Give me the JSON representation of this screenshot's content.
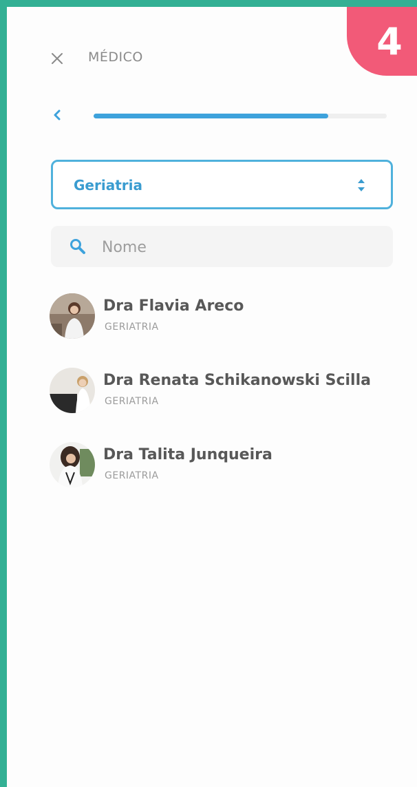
{
  "step_badge": "4",
  "header": {
    "title": "MÉDICO"
  },
  "progress": {
    "value_percent": 80
  },
  "specialty_select": {
    "value": "Geriatria"
  },
  "search": {
    "placeholder": "Nome",
    "value": ""
  },
  "doctors": [
    {
      "name": "Dra Flavia Areco",
      "specialty": "GERIATRIA"
    },
    {
      "name": "Dra Renata Schikanowski Scilla",
      "specialty": "GERIATRIA"
    },
    {
      "name": "Dra Talita Junqueira",
      "specialty": "GERIATRIA"
    }
  ],
  "colors": {
    "frame": "#33b094",
    "badge": "#f25a78",
    "accent": "#3da2dc"
  }
}
